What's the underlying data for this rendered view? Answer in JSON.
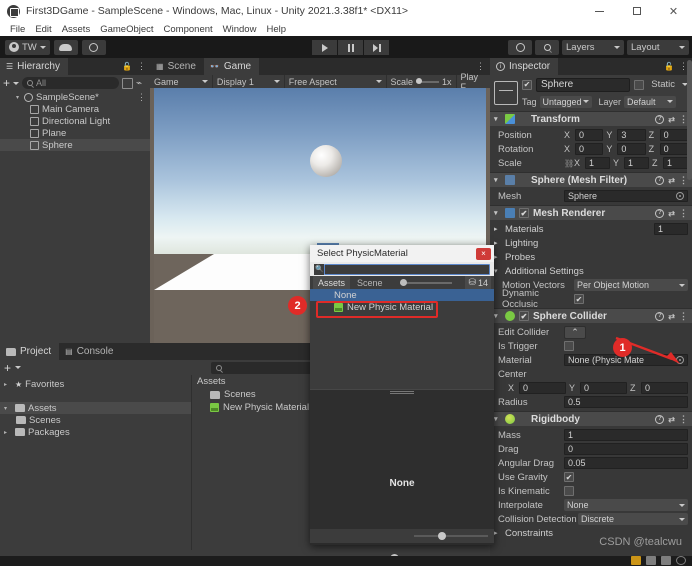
{
  "window": {
    "title": "First3DGame - SampleScene - Windows, Mac, Linux - Unity 2021.3.38f1* <DX11>",
    "minimize": "–",
    "maximize": "□",
    "close": "×"
  },
  "menubar": {
    "items": [
      "File",
      "Edit",
      "Assets",
      "GameObject",
      "Component",
      "Window",
      "Help"
    ]
  },
  "toolbar": {
    "account": "TW",
    "cloud_icon": "cloud-icon",
    "settings_icon": "gear-icon",
    "play": "play-icon",
    "pause": "pause-icon",
    "step": "step-icon",
    "history_icon": "history-icon",
    "search_icon": "search-icon",
    "layers": "Layers",
    "layout": "Layout"
  },
  "hierarchy": {
    "tab": "Hierarchy",
    "add_label": "+",
    "search_placeholder": "All",
    "items": [
      {
        "label": "SampleScene*",
        "depth": 0,
        "selected": false,
        "expander": "▾"
      },
      {
        "label": "Main Camera",
        "depth": 1,
        "selected": false,
        "expander": ""
      },
      {
        "label": "Directional Light",
        "depth": 1,
        "selected": false,
        "expander": ""
      },
      {
        "label": "Plane",
        "depth": 1,
        "selected": false,
        "expander": ""
      },
      {
        "label": "Sphere",
        "depth": 1,
        "selected": true,
        "expander": ""
      }
    ]
  },
  "sceneview": {
    "tabs": [
      {
        "label": "Scene",
        "active": false,
        "icon": "scene-icon"
      },
      {
        "label": "Game",
        "active": true,
        "icon": "game-icon"
      }
    ],
    "toolbar": {
      "target": "Game",
      "display": "Display 1",
      "aspect": "Free Aspect",
      "scale_label": "Scale",
      "scale_value": "1x",
      "play_focused": "Play F"
    }
  },
  "inspector": {
    "tab": "Inspector",
    "object_name": "Sphere",
    "enabled": "✔",
    "static_label": "Static",
    "tag_label": "Tag",
    "tag_value": "Untagged",
    "layer_label": "Layer",
    "layer_value": "Default",
    "components": [
      {
        "name": "Transform",
        "icon": "transform-icon",
        "rows": [
          {
            "label": "Position",
            "x": "0",
            "y": "3",
            "z": "0"
          },
          {
            "label": "Rotation",
            "x": "0",
            "y": "0",
            "z": "0"
          },
          {
            "label": "Scale",
            "x": "1",
            "y": "1",
            "z": "1"
          }
        ]
      },
      {
        "name": "Sphere (Mesh Filter)",
        "icon": "mesh-filter-icon",
        "mesh_label": "Mesh",
        "mesh_value": "Sphere"
      },
      {
        "name": "Mesh Renderer",
        "icon": "mesh-renderer-icon",
        "materials_label": "Materials",
        "materials_count": "1",
        "lighting_label": "Lighting",
        "probes_label": "Probes",
        "additional_label": "Additional Settings",
        "motion_vectors_label": "Motion Vectors",
        "motion_vectors_value": "Per Object Motion",
        "dynamic_occlusion_label": "Dynamic Occlusic"
      },
      {
        "name": "Sphere Collider",
        "icon": "sphere-collider-icon",
        "edit_collider_label": "Edit Collider",
        "is_trigger_label": "Is Trigger",
        "material_label": "Material",
        "material_value": "None (Physic Mate",
        "center_label": "Center",
        "center": {
          "x": "0",
          "y": "0",
          "z": "0"
        },
        "radius_label": "Radius",
        "radius_value": "0.5"
      },
      {
        "name": "Rigidbody",
        "icon": "rigidbody-icon",
        "rows": [
          {
            "label": "Mass",
            "value": "1"
          },
          {
            "label": "Drag",
            "value": "0"
          },
          {
            "label": "Angular Drag",
            "value": "0.05"
          }
        ],
        "use_gravity_label": "Use Gravity",
        "is_kinematic_label": "Is Kinematic",
        "interpolate_label": "Interpolate",
        "interpolate_value": "None",
        "collision_label": "Collision Detection",
        "collision_value": "Discrete",
        "constraints_label": "Constraints"
      }
    ]
  },
  "project": {
    "tabs": [
      {
        "label": "Project",
        "active": true,
        "icon": "folder-icon"
      },
      {
        "label": "Console",
        "active": false,
        "icon": "console-icon"
      }
    ],
    "tree": [
      {
        "label": "Favorites",
        "depth": 0,
        "expander": "▸",
        "icon": "star-icon",
        "selected": false
      },
      {
        "label": "Assets",
        "depth": 0,
        "expander": "▾",
        "icon": "folder-icon",
        "selected": true
      },
      {
        "label": "Scenes",
        "depth": 1,
        "expander": "",
        "icon": "folder-icon",
        "selected": false
      },
      {
        "label": "Packages",
        "depth": 0,
        "expander": "▸",
        "icon": "folder-icon",
        "selected": false
      }
    ],
    "content_header": "Assets",
    "content_items": [
      {
        "label": "Scenes",
        "icon": "folder-icon"
      },
      {
        "label": "New Physic Material",
        "icon": "physic-material-icon"
      }
    ]
  },
  "dialog": {
    "title": "Select PhysicMaterial",
    "close": "×",
    "search_value": "",
    "tabs": [
      {
        "label": "Assets",
        "active": true
      },
      {
        "label": "Scene",
        "active": false
      }
    ],
    "count": "14",
    "items": [
      {
        "label": "None",
        "selected": true,
        "icon": ""
      },
      {
        "label": "New Physic Material",
        "selected": false,
        "icon": "physic-material-icon"
      }
    ],
    "preview_label": "None"
  },
  "annotations": [
    {
      "number": "1",
      "target": "collider-material-field"
    },
    {
      "number": "2",
      "target": "new-physic-material-item"
    }
  ],
  "watermark": "CSDN @tealcwu",
  "colors": {
    "accent_red": "#e02b28",
    "selection_blue": "#3a6294",
    "panel_bg": "#383838",
    "header_bg": "#4a4a4a",
    "dark_bg": "#2b2b2b"
  }
}
